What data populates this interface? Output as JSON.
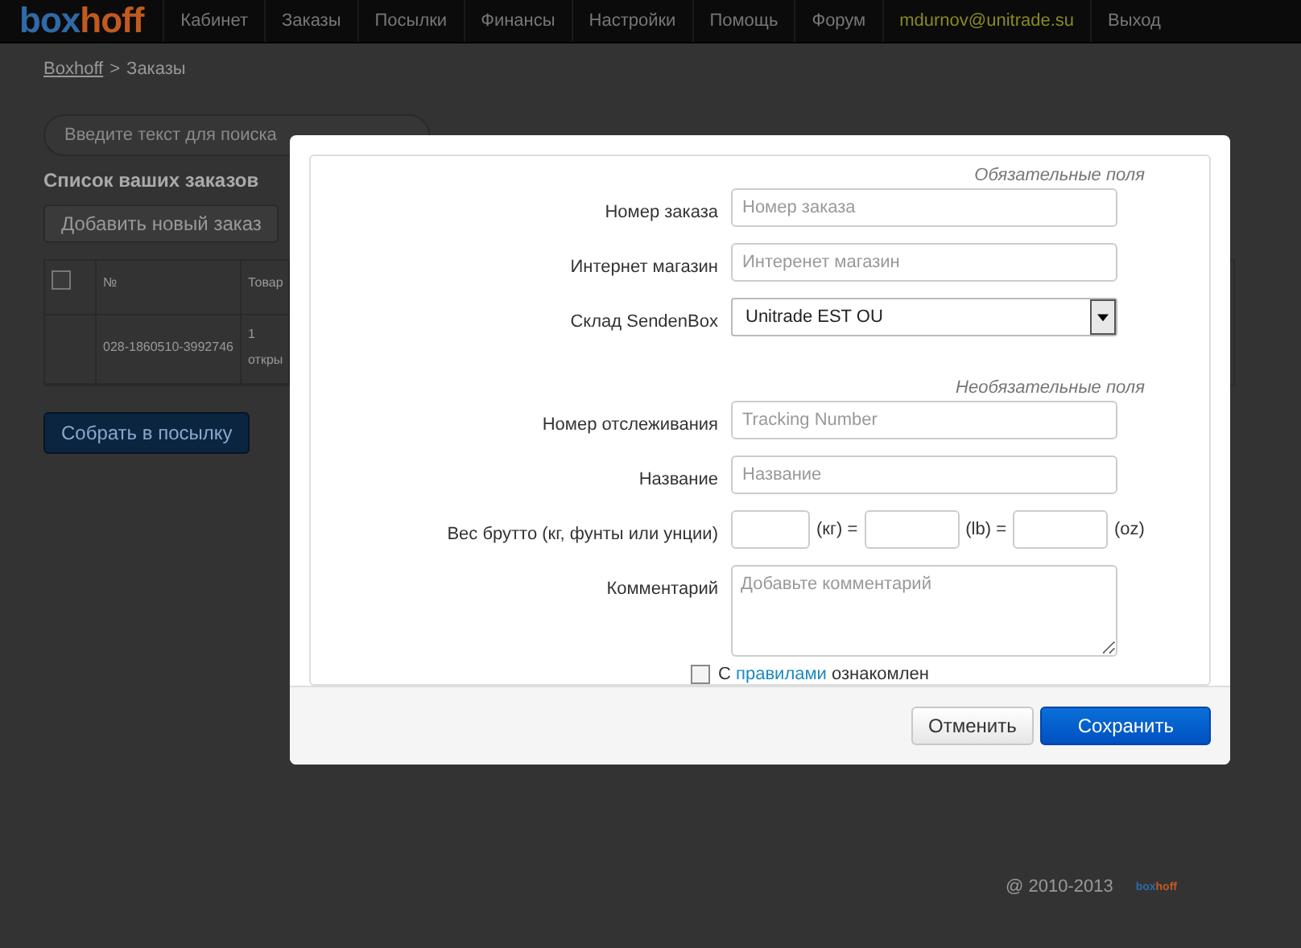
{
  "nav": {
    "logo": {
      "part_1": "box",
      "part_2": "hoff"
    },
    "items": [
      {
        "label": "Кабинет"
      },
      {
        "label": "Заказы"
      },
      {
        "label": "Посылки"
      },
      {
        "label": "Финансы"
      },
      {
        "label": "Настройки"
      },
      {
        "label": "Помощь"
      },
      {
        "label": "Форум"
      }
    ],
    "user": "mdurnov@unitrade.su",
    "logout": "Выход"
  },
  "breadcrumb": {
    "link": "Boxhoff",
    "separator": ">",
    "current": "Заказы"
  },
  "search": {
    "placeholder": "Введите текст для поиска"
  },
  "orders": {
    "title": "Список ваших заказов",
    "add_button": "Добавить новый заказ",
    "table": {
      "columns": [
        {
          "kind": "checkbox",
          "checked": false
        },
        {
          "kind": "text",
          "label": "№"
        },
        {
          "kind": "text",
          "label": "Товар"
        }
      ],
      "rows": [
        {
          "cells": [
            "",
            "028-1860510-3992746",
            "1\nоткры"
          ]
        }
      ]
    },
    "collect_button": "Собрать в посылку"
  },
  "footer": {
    "copyright": "@ 2010-2013",
    "logo": {
      "part_1": "box",
      "part_2": "hoff"
    }
  },
  "dialog": {
    "sections": [
      {
        "title": "Обязательные поля",
        "fields": [
          {
            "kind": "input",
            "label": "Номер заказа",
            "placeholder": "Номер заказа"
          },
          {
            "kind": "input",
            "label": "Интернет магазин",
            "placeholder": "Интеренет магазин"
          },
          {
            "kind": "select",
            "label": "Склад SendenBox",
            "value": "Unitrade EST OU"
          }
        ]
      },
      {
        "title": "Необязательные поля",
        "fields": [
          {
            "kind": "input",
            "label": "Номер отслеживания",
            "placeholder": "Tracking Number"
          },
          {
            "kind": "input",
            "label": "Название",
            "placeholder": "Название"
          },
          {
            "kind": "weight",
            "label": "Вес брутто (кг, фунты или унции)",
            "units": [
              "(кг) =",
              "(lb) =",
              "(oz)"
            ]
          },
          {
            "kind": "textarea",
            "label": "Комментарий",
            "placeholder": "Добавьте комментарий"
          }
        ]
      }
    ],
    "agreement": {
      "checked": false,
      "before": "С",
      "link": "правилами",
      "after": "ознакомлен"
    },
    "buttons": [
      {
        "kind": "secondary",
        "label": "Отменить"
      },
      {
        "kind": "primary",
        "label": "Сохранить"
      }
    ]
  }
}
